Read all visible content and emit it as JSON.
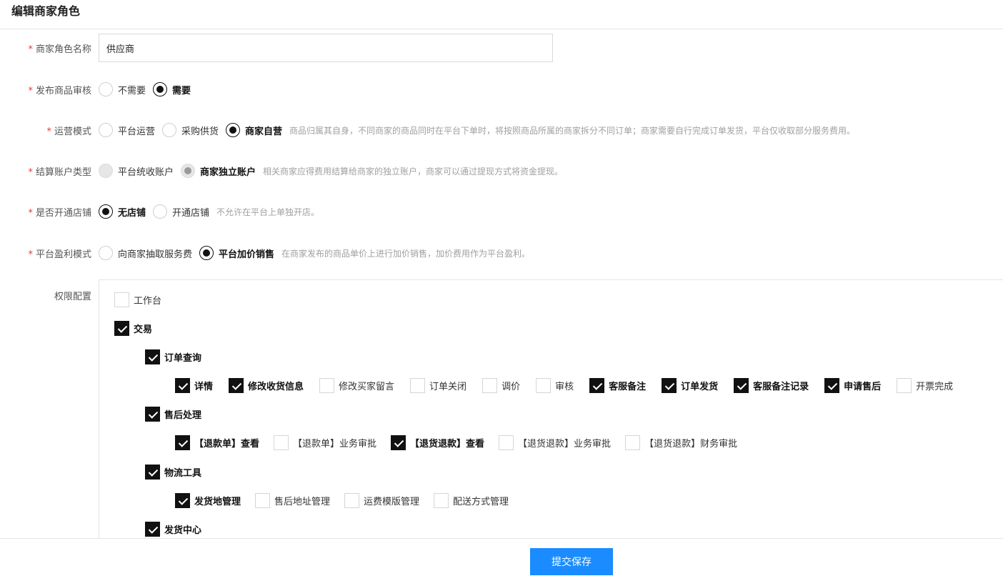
{
  "page": {
    "title": "编辑商家角色"
  },
  "form": {
    "role_name": {
      "label": "商家角色名称",
      "value": "供应商"
    },
    "audit": {
      "label": "发布商品审核",
      "options": [
        "不需要",
        "需要"
      ],
      "selected": "需要"
    },
    "mode": {
      "label": "运营模式",
      "options": [
        "平台运营",
        "采购供货",
        "商家自营"
      ],
      "selected": "商家自营",
      "hint": "商品归属其自身，不同商家的商品同时在平台下单时，将按照商品所属的商家拆分不同订单；商家需要自行完成订单发货，平台仅收取部分服务费用。"
    },
    "settlement": {
      "label": "结算账户类型",
      "options": [
        "平台统收账户",
        "商家独立账户"
      ],
      "selected": "商家独立账户",
      "disabled": true,
      "hint": "相关商家应得费用结算给商家的独立账户，商家可以通过提现方式将资金提现。"
    },
    "store": {
      "label": "是否开通店铺",
      "options": [
        "无店铺",
        "开通店铺"
      ],
      "selected": "无店铺",
      "hint": "不允许在平台上单独开店。"
    },
    "profit": {
      "label": "平台盈利模式",
      "options": [
        "向商家抽取服务费",
        "平台加价销售"
      ],
      "selected": "平台加价销售",
      "hint": "在商家发布的商品单价上进行加价销售，加价费用作为平台盈利。"
    }
  },
  "permissions": {
    "label": "权限配置",
    "workbench": {
      "label": "工作台",
      "checked": false
    },
    "trade": {
      "label": "交易",
      "checked": true
    },
    "order_query": {
      "label": "订单查询",
      "checked": true,
      "items": [
        {
          "label": "详情",
          "checked": true
        },
        {
          "label": "修改收货信息",
          "checked": true
        },
        {
          "label": "修改买家留言",
          "checked": false
        },
        {
          "label": "订单关闭",
          "checked": false
        },
        {
          "label": "调价",
          "checked": false
        },
        {
          "label": "审核",
          "checked": false
        },
        {
          "label": "客服备注",
          "checked": true
        },
        {
          "label": "订单发货",
          "checked": true
        },
        {
          "label": "客服备注记录",
          "checked": true
        },
        {
          "label": "申请售后",
          "checked": true
        },
        {
          "label": "开票完成",
          "checked": false
        }
      ]
    },
    "after_sale": {
      "label": "售后处理",
      "checked": true,
      "items": [
        {
          "label": "【退款单】查看",
          "checked": true
        },
        {
          "label": "【退款单】业务审批",
          "checked": false
        },
        {
          "label": "【退货退款】查看",
          "checked": true
        },
        {
          "label": "【退货退款】业务审批",
          "checked": false
        },
        {
          "label": "【退货退款】财务审批",
          "checked": false
        }
      ]
    },
    "logistics": {
      "label": "物流工具",
      "checked": true,
      "items": [
        {
          "label": "发货地管理",
          "checked": true
        },
        {
          "label": "售后地址管理",
          "checked": false
        },
        {
          "label": "运费模版管理",
          "checked": false
        },
        {
          "label": "配送方式管理",
          "checked": false
        }
      ]
    },
    "shipping": {
      "label": "发货中心",
      "checked": true
    }
  },
  "footer": {
    "submit_label": "提交保存"
  },
  "colors": {
    "primary": "#1a8cff",
    "required": "#e33b3b",
    "check": "#111111",
    "hint": "#a0a0a0"
  }
}
